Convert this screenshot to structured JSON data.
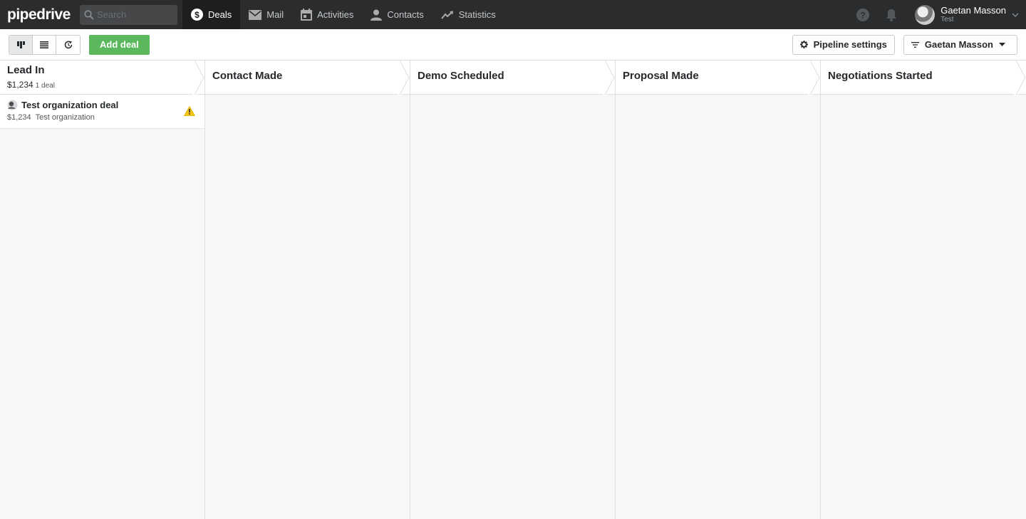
{
  "app": {
    "logo": "pipedrive"
  },
  "search": {
    "placeholder": "Search"
  },
  "nav": {
    "items": [
      {
        "label": "Deals",
        "icon": "dollar-icon",
        "active": true
      },
      {
        "label": "Mail",
        "icon": "mail-icon"
      },
      {
        "label": "Activities",
        "icon": "calendar-icon"
      },
      {
        "label": "Contacts",
        "icon": "person-icon"
      },
      {
        "label": "Statistics",
        "icon": "trend-icon"
      }
    ]
  },
  "user": {
    "name": "Gaetan Masson",
    "company": "Test"
  },
  "toolbar": {
    "views": [
      "kanban-view-icon",
      "list-view-icon",
      "forecast-view-icon"
    ],
    "add_deal_label": "Add deal",
    "pipeline_settings_label": "Pipeline settings",
    "owner_filter_label": "Gaetan Masson"
  },
  "stages": [
    {
      "title": "Lead In",
      "value": "$1,234",
      "count": "1 deal",
      "deals": [
        {
          "title": "Test organization deal",
          "value": "$1,234",
          "organization": "Test organization",
          "warning": true
        }
      ]
    },
    {
      "title": "Contact Made"
    },
    {
      "title": "Demo Scheduled"
    },
    {
      "title": "Proposal Made"
    },
    {
      "title": "Negotiations Started"
    }
  ],
  "colors": {
    "topbar": "#2a2c2e",
    "accent_green": "#5cb85c",
    "warning": "#f5c518"
  }
}
